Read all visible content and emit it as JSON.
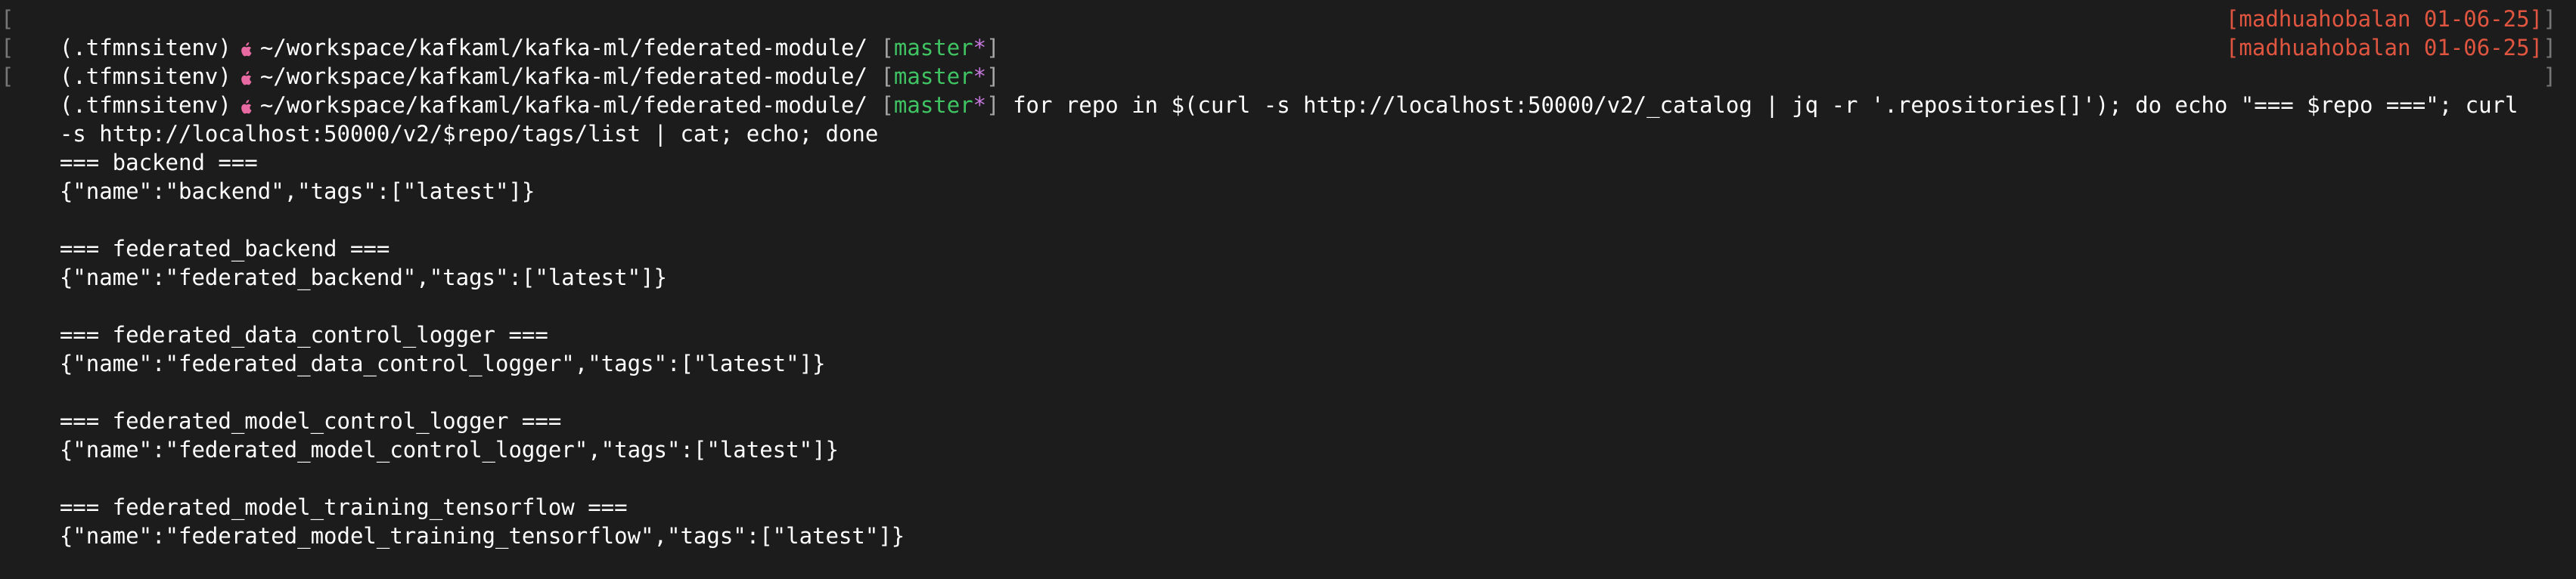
{
  "prompt": {
    "venv": "(.tfmnsitenv)",
    "icon": "apple-icon",
    "path": "~/workspace/kafkaml/kafka-ml/federated-module/",
    "git_open": "[",
    "branch": "master",
    "dirty": "*",
    "git_close": "]",
    "right_prompt": "[madhuahobalan 01-06-25]",
    "edge_mark": "]",
    "lead_mark": "["
  },
  "command": {
    "line1": "for repo in $(curl -s http://localhost:50000/v2/_catalog | jq -r '.repositories[]'); do echo \"=== $repo ===\"; curl",
    "line2": "-s http://localhost:50000/v2/$repo/tags/list | cat; echo; done"
  },
  "output": [
    {
      "header": "=== backend ===",
      "json": "{\"name\":\"backend\",\"tags\":[\"latest\"]}"
    },
    {
      "header": "=== federated_backend ===",
      "json": "{\"name\":\"federated_backend\",\"tags\":[\"latest\"]}"
    },
    {
      "header": "=== federated_data_control_logger ===",
      "json": "{\"name\":\"federated_data_control_logger\",\"tags\":[\"latest\"]}"
    },
    {
      "header": "=== federated_model_control_logger ===",
      "json": "{\"name\":\"federated_model_control_logger\",\"tags\":[\"latest\"]}"
    },
    {
      "header": "=== federated_model_training_tensorflow ===",
      "json": "{\"name\":\"federated_model_training_tensorflow\",\"tags\":[\"latest\"]}"
    }
  ],
  "colors": {
    "background": "#1c1c1c",
    "text": "#ffffff",
    "branch": "#40c463",
    "dirty": "#c678dd",
    "right_prompt": "#e0553f",
    "apple_icon": "#e86aa2"
  }
}
